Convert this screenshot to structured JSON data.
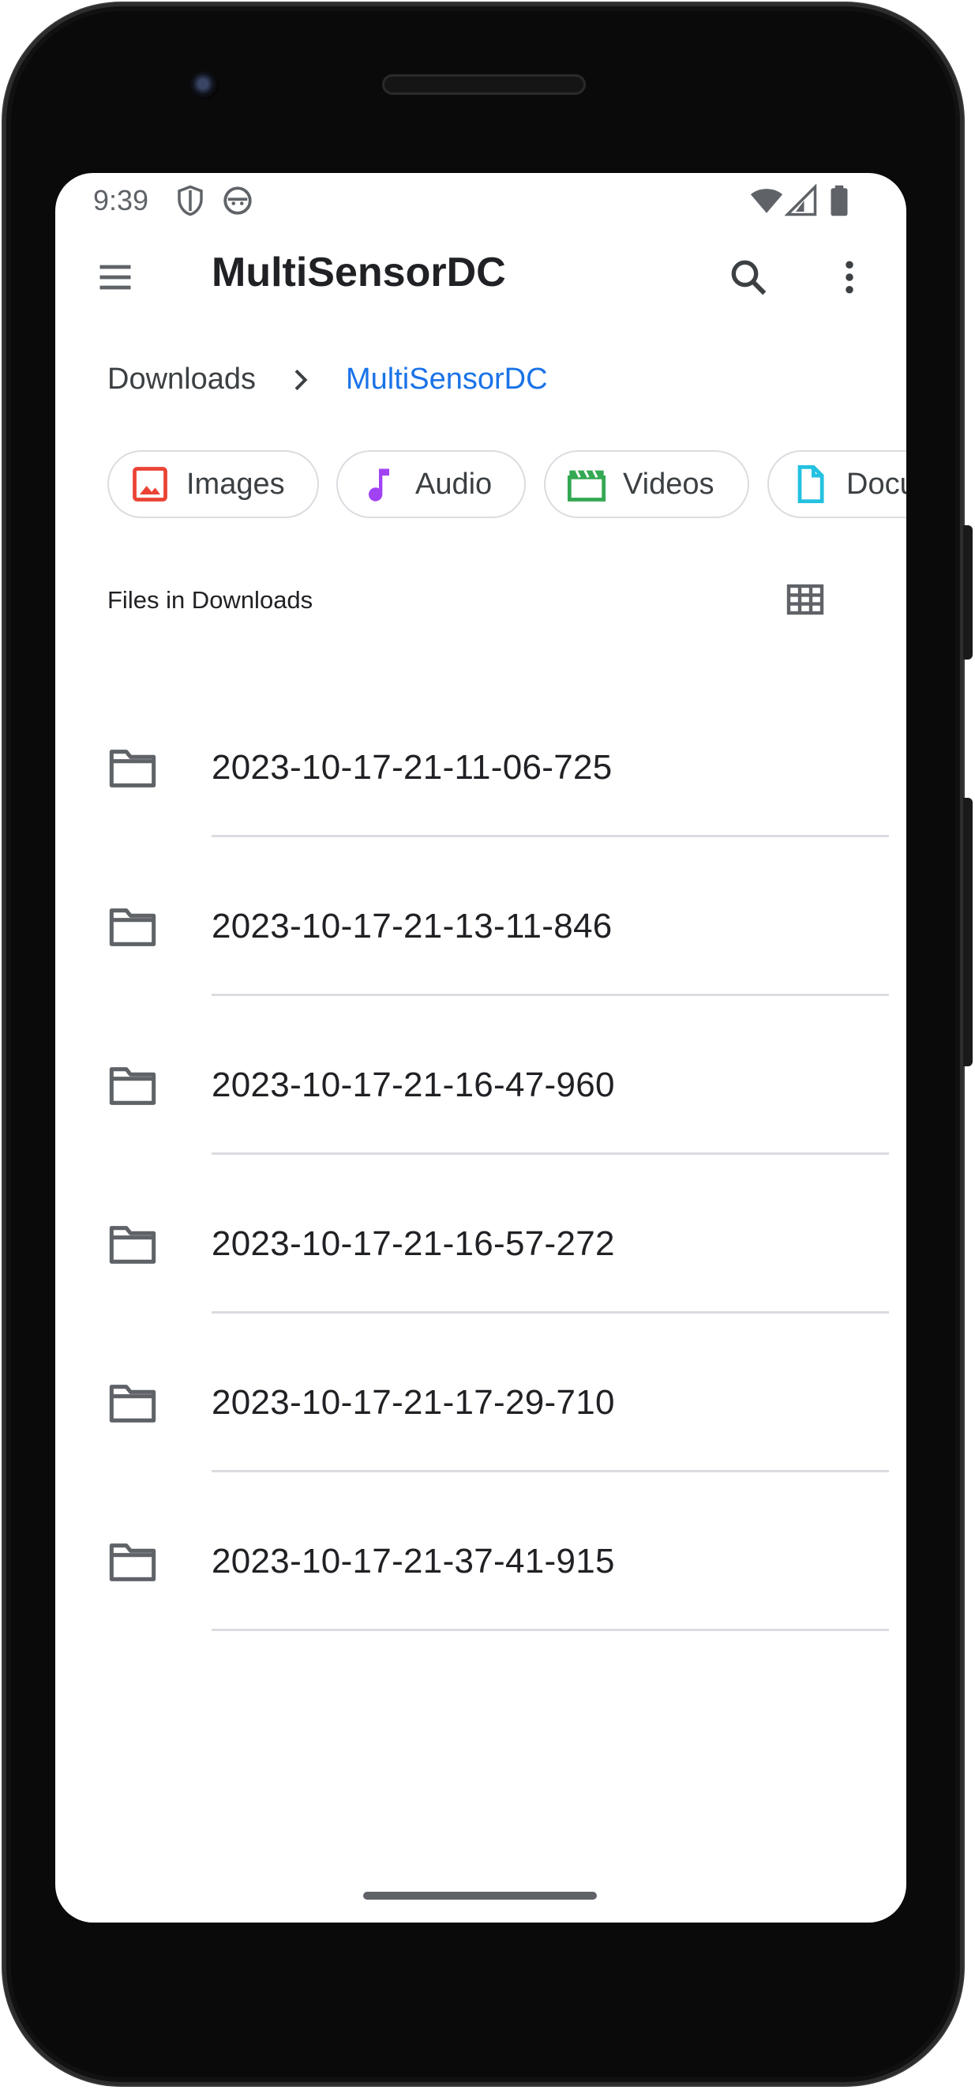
{
  "status_bar": {
    "time": "9:39",
    "left_icons": [
      "shield-icon",
      "app-notification-icon"
    ],
    "right_icons": [
      "wifi-icon",
      "cellular-signal-icon",
      "battery-icon"
    ]
  },
  "app_bar": {
    "title": "MultiSensorDC",
    "menu_icon": "hamburger-menu-icon",
    "actions": [
      "search-icon",
      "more-vert-icon"
    ]
  },
  "breadcrumb": {
    "items": [
      "Downloads",
      "MultiSensorDC"
    ],
    "separator": "chevron-right-icon",
    "active_color": "#1a73e8"
  },
  "filter_chips": [
    {
      "label": "Images",
      "icon": "image-icon",
      "color": "#ea4335"
    },
    {
      "label": "Audio",
      "icon": "music-note-icon",
      "color": "#a142f4"
    },
    {
      "label": "Videos",
      "icon": "movie-clapper-icon",
      "color": "#34a853"
    },
    {
      "label": "Documents",
      "icon": "document-icon",
      "color": "#24c1e0"
    }
  ],
  "section": {
    "title": "Files in Downloads",
    "view_toggle_icon": "grid-view-icon"
  },
  "files": [
    {
      "name": "2023-10-17-21-11-06-725",
      "icon": "folder-icon"
    },
    {
      "name": "2023-10-17-21-13-11-846",
      "icon": "folder-icon"
    },
    {
      "name": "2023-10-17-21-16-47-960",
      "icon": "folder-icon"
    },
    {
      "name": "2023-10-17-21-16-57-272",
      "icon": "folder-icon"
    },
    {
      "name": "2023-10-17-21-17-29-710",
      "icon": "folder-icon"
    },
    {
      "name": "2023-10-17-21-37-41-915",
      "icon": "folder-icon"
    }
  ]
}
